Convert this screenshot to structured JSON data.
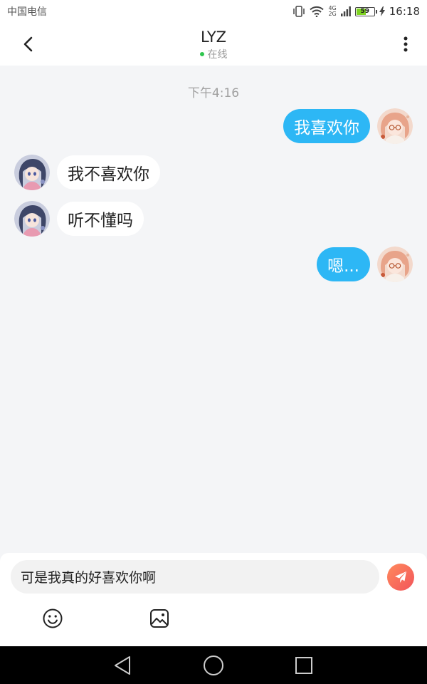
{
  "status_bar": {
    "carrier": "中国电信",
    "network_top": "4G",
    "network_bottom": "2G",
    "battery": "59",
    "battery_level": 0.59,
    "time": "16:18",
    "icons": [
      "vibrate-icon",
      "wifi-icon",
      "signal-icon",
      "battery-icon",
      "charging-icon"
    ]
  },
  "header": {
    "contact_name": "LYZ",
    "presence": "在线",
    "presence_color": "#2fc64e"
  },
  "conversation": {
    "timestamp": "下午4:16",
    "messages": [
      {
        "sender": "me",
        "text": "我喜欢你"
      },
      {
        "sender": "them",
        "text": "我不喜欢你"
      },
      {
        "sender": "them",
        "text": "听不懂吗"
      },
      {
        "sender": "me",
        "text": "嗯..."
      }
    ]
  },
  "composer": {
    "input_value": "可是我真的好喜欢你啊",
    "send_icon": "paper-plane-icon",
    "tools": [
      "emoji-icon",
      "image-icon"
    ]
  },
  "colors": {
    "my_bubble": "#2db7f5",
    "their_bubble": "#ffffff",
    "background": "#f4f5f7",
    "send_gradient_start": "#ff8a5c",
    "send_gradient_end": "#f2545b"
  }
}
